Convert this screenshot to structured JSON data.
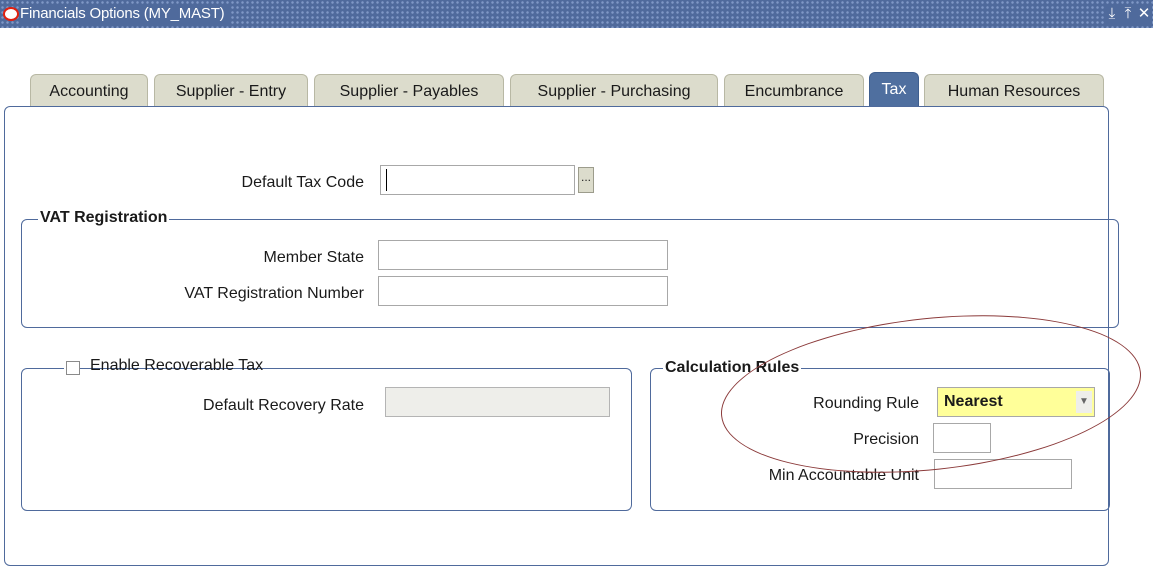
{
  "window": {
    "title": "Financials Options (MY_MAST)",
    "controls": {
      "minimize": "⤓",
      "maximize": "⤒",
      "close": "✕"
    }
  },
  "tabs": [
    {
      "label": "Accounting",
      "active": false
    },
    {
      "label": "Supplier - Entry",
      "active": false
    },
    {
      "label": "Supplier - Payables",
      "active": false
    },
    {
      "label": "Supplier - Purchasing",
      "active": false
    },
    {
      "label": "Encumbrance",
      "active": false
    },
    {
      "label": "Tax",
      "active": true
    },
    {
      "label": "Human Resources",
      "active": false
    }
  ],
  "tax": {
    "default_tax_code": {
      "label": "Default Tax Code",
      "value": "",
      "lov_icon": "..."
    },
    "vat_registration": {
      "title": "VAT Registration",
      "member_state": {
        "label": "Member State",
        "value": ""
      },
      "vat_registration_number": {
        "label": "VAT Registration Number",
        "value": ""
      }
    },
    "recoverable_tax": {
      "checkbox_label": "Enable Recoverable Tax",
      "checked": false,
      "default_recovery_rate": {
        "label": "Default Recovery Rate",
        "value": ""
      }
    },
    "calculation_rules": {
      "title": "Calculation Rules",
      "rounding_rule": {
        "label": "Rounding Rule",
        "value": "Nearest"
      },
      "precision": {
        "label": "Precision",
        "value": ""
      },
      "min_accountable_unit": {
        "label": "Min Accountable Unit",
        "value": ""
      }
    }
  },
  "colors": {
    "titlebar": "#4f6a9c",
    "required_field": "#ffff99",
    "annotation": "#8b3a3a"
  }
}
